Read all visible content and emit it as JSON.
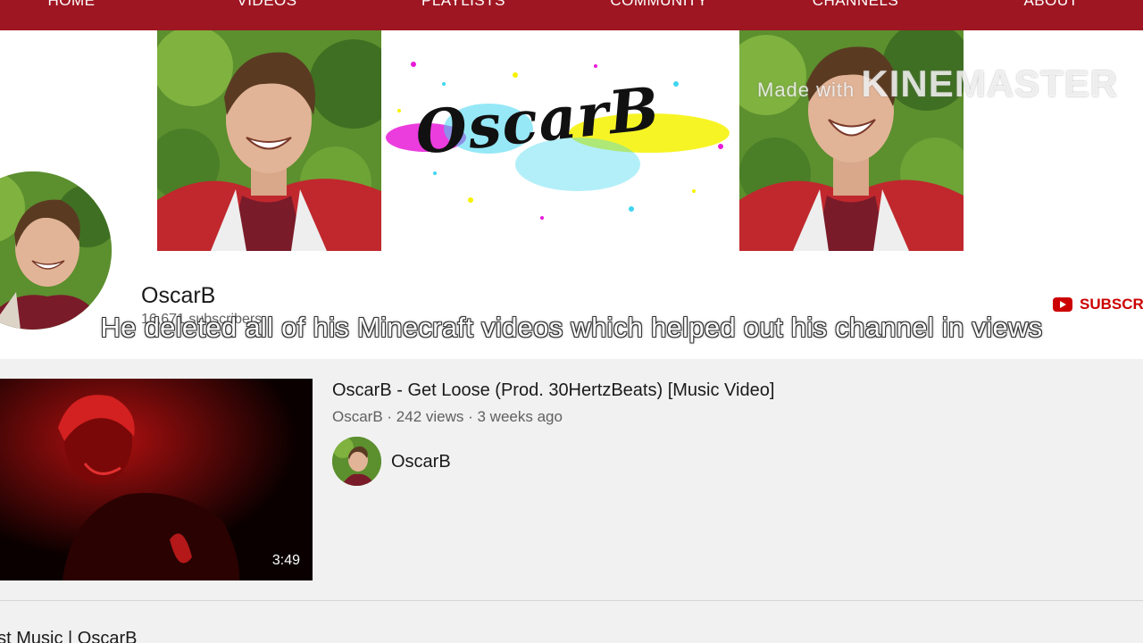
{
  "nav": {
    "tabs": [
      {
        "label": "HOME"
      },
      {
        "label": "VIDEOS"
      },
      {
        "label": "PLAYLISTS"
      },
      {
        "label": "COMMUNITY"
      },
      {
        "label": "CHANNELS"
      },
      {
        "label": "ABOUT"
      }
    ],
    "bar_color": "#9e1622"
  },
  "banner": {
    "logo": "OscarB",
    "watermark_prefix": "Made with ",
    "watermark_brand": "KINEMASTER"
  },
  "channel": {
    "name": "OscarB",
    "subscribers": "16,671 subscribers",
    "subscribe_label": "SUBSCR"
  },
  "caption": "He deleted all of his Minecraft videos which helped out his channel in views",
  "video": {
    "title": "OscarB - Get Loose (Prod. 30HertzBeats) [Music Video]",
    "meta": "OscarB · 242 views · 3 weeks ago",
    "duration": "3:49",
    "channel": "OscarB"
  },
  "section": {
    "title": "ast Music | OscarB"
  },
  "icons": {
    "subscribe": "youtube-play-icon"
  },
  "colors": {
    "accent": "#cc0000",
    "nav": "#9e1622"
  }
}
